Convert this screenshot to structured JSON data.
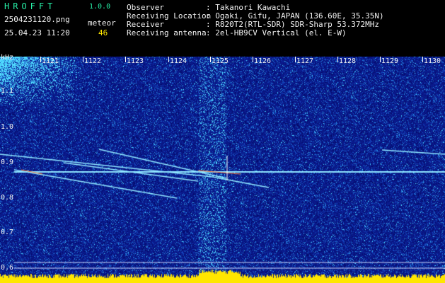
{
  "header": {
    "app_title": "HROFFT",
    "version": "1.0.0",
    "filename": "2504231120.png",
    "detection_label": "meteor",
    "datetime": "25.04.23 11:20",
    "meteor_count": "46",
    "info": [
      {
        "label": "Observer",
        "value": ": Takanori Kawachi"
      },
      {
        "label": "Receiving Location",
        "value": ": Ogaki, Gifu, JAPAN (136.60E, 35.35N)"
      },
      {
        "label": "Receiver",
        "value": ": R820T2(RTL-SDR) SDR-Sharp 53.372MHz"
      },
      {
        "label": "Receiving antenna",
        "value": ": 2el-HB9CV Vertical (el. E-W)"
      }
    ]
  },
  "spectrogram": {
    "y_unit": "kHz",
    "y_labels": [
      "1.1",
      "1.0",
      "0.9",
      "0.8",
      "0.7",
      "0.6"
    ],
    "x_labels": [
      "1121",
      "1122",
      "1123",
      "1124",
      "1125",
      "1126",
      "1127",
      "1128",
      "1129",
      "1130"
    ],
    "colors": {
      "background": "#0a1a8c",
      "echo_line": "#8fe6ff",
      "spectrum_bar": "#ffe600"
    }
  }
}
